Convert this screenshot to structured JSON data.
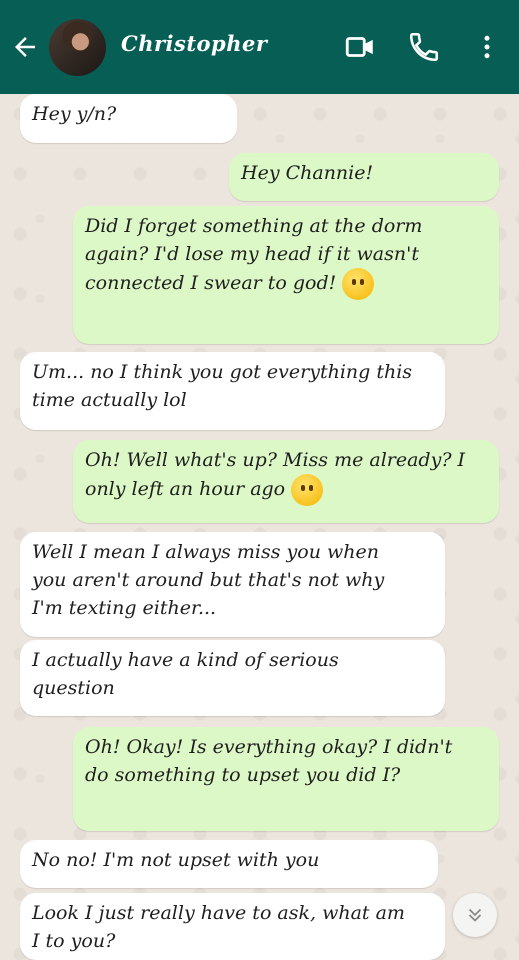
{
  "header": {
    "contact_name": "Christopher",
    "icons": {
      "back": "arrow-left-icon",
      "video": "video-camera-icon",
      "call": "phone-icon",
      "menu": "more-vertical-icon"
    },
    "colors": {
      "bar": "#075e54"
    }
  },
  "messages": [
    {
      "dir": "in",
      "text": "Hey y/n?"
    },
    {
      "dir": "out",
      "text": "Hey Channie!"
    },
    {
      "dir": "out",
      "text": "Did I forget something at the dorm\nagain? I'd lose my head if it wasn't\nconnected I swear to god!",
      "emoji": "sweat-smile-emoji"
    },
    {
      "dir": "in",
      "text": "Um... no I think you got everything this\ntime actually lol"
    },
    {
      "dir": "out",
      "text": "Oh! Well what's up? Miss me already? I\nonly left an hour ago",
      "emoji": "hand-over-mouth-emoji"
    },
    {
      "dir": "in",
      "text": "Well I mean I always miss you when\nyou aren't around but that's not why\nI'm texting either..."
    },
    {
      "dir": "in",
      "text": "I actually have a kind of serious\nquestion"
    },
    {
      "dir": "out",
      "text": "Oh! Okay! Is everything okay? I didn't\ndo something to upset you did I?"
    },
    {
      "dir": "in",
      "text": "No no! I'm not upset with you"
    },
    {
      "dir": "in",
      "text": "Look I just really have to ask, what am\nI to you?"
    }
  ],
  "scroll_button": {
    "icon": "double-chevron-down-icon"
  },
  "colors": {
    "incoming": "#ffffff",
    "outgoing": "#dcf8c6",
    "background": "#ece5dd"
  }
}
